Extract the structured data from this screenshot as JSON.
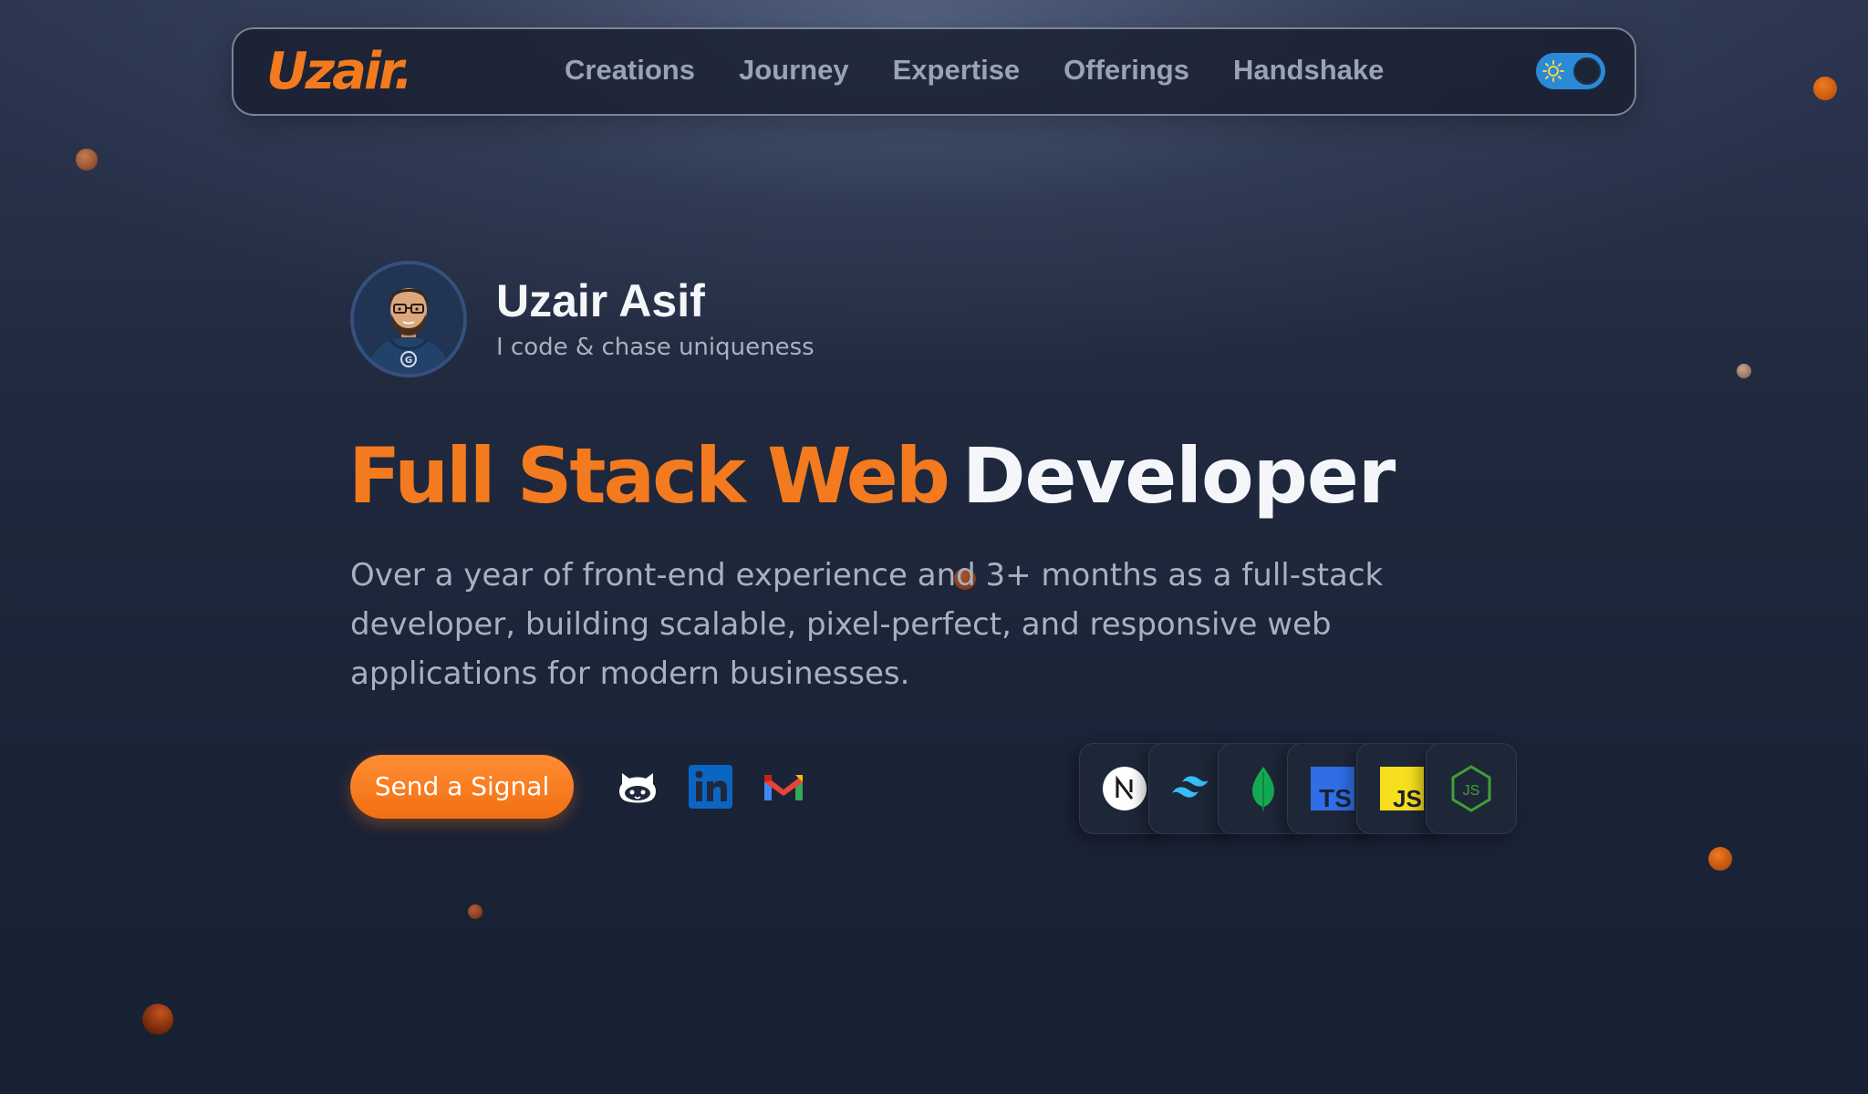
{
  "nav": {
    "logo": "Uzair.",
    "links": [
      "Creations",
      "Journey",
      "Expertise",
      "Offerings",
      "Handshake"
    ],
    "theme_toggle_icon": "sun-icon"
  },
  "profile": {
    "name": "Uzair Asif",
    "tagline": "I code & chase uniqueness"
  },
  "hero": {
    "title_accent": "Full Stack Web",
    "title_plain": "Developer",
    "description": "Over a year of front-end experience and 3+ months as a full-stack developer, building scalable, pixel-perfect, and responsive web applications for modern businesses.",
    "cta_label": "Send a Signal"
  },
  "socials": [
    "github-icon",
    "linkedin-icon",
    "gmail-icon"
  ],
  "tech_stack": [
    "nextjs-icon",
    "tailwind-icon",
    "mongodb-icon",
    "typescript-icon",
    "javascript-icon",
    "nodejs-icon"
  ],
  "colors": {
    "accent": "#f47a1f",
    "background": "#1f283c",
    "text": "#f4f6fa",
    "muted": "#a9b1c0"
  }
}
